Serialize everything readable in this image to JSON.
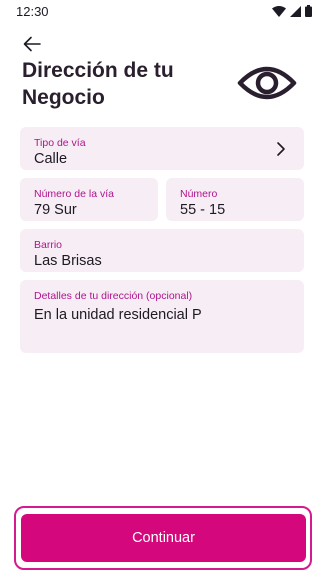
{
  "status_bar": {
    "time": "12:30",
    "icons": [
      "wifi-icon",
      "signal-icon",
      "battery-icon"
    ]
  },
  "header": {
    "back_icon": "arrow-left-icon",
    "title_line1": "Dirección de tu",
    "title_line2": "Negocio",
    "visibility_icon": "eye-icon"
  },
  "form": {
    "tipo_via": {
      "label": "Tipo de vía",
      "value": "Calle",
      "icon": "chevron-right-icon"
    },
    "numero_via": {
      "label": "Número de la vía",
      "value": "79 Sur"
    },
    "numero": {
      "label": "Número",
      "value": "55 - 15"
    },
    "barrio": {
      "label": "Barrio",
      "value": "Las Brisas"
    },
    "detalles": {
      "label": "Detalles de tu dirección (opcional)",
      "value": "En la unidad residencial P"
    }
  },
  "footer": {
    "continue_label": "Continuar"
  },
  "colors": {
    "accent": "#d4087c",
    "label": "#b0138f",
    "field_bg": "#f6eef4",
    "text": "#1d1a24"
  }
}
